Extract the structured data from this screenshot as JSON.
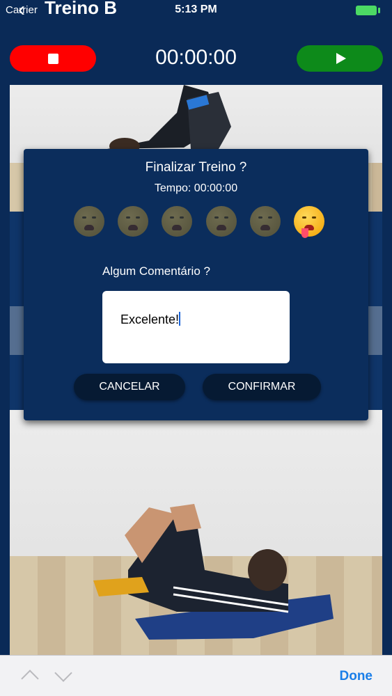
{
  "status": {
    "carrier": "Carrier",
    "time": "5:13 PM"
  },
  "nav": {
    "title": "Treino B"
  },
  "workout": {
    "timer": "00:00:00"
  },
  "dialog": {
    "title": "Finalizar Treino ?",
    "time_text": "Tempo: 00:00:00",
    "emoji_count": 6,
    "selected_emoji_index": 5,
    "comment_label": "Algum Comentário ?",
    "comment_value": "Excelente!",
    "cancel_label": "CANCELAR",
    "confirm_label": "CONFIRMAR"
  },
  "keyboard_bar": {
    "done_label": "Done"
  },
  "colors": {
    "background": "#0a2a57",
    "stop": "#ff0000",
    "play": "#0d8a1a",
    "done": "#1a7ee8"
  }
}
